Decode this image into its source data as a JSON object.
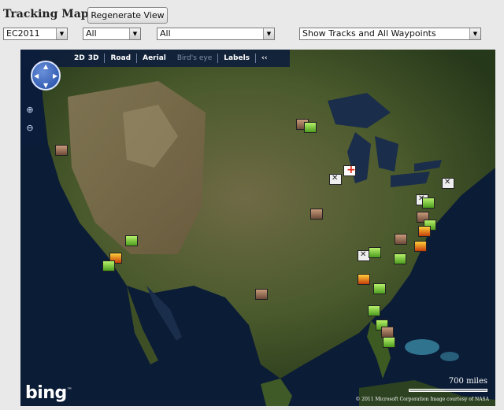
{
  "header": {
    "title": "Tracking Map",
    "regenerate_label": "Regenerate View"
  },
  "filters": {
    "event": "EC2011",
    "filter2": "All",
    "filter3": "All",
    "display_mode": "Show Tracks and All Waypoints"
  },
  "map": {
    "nav": {
      "view_2d": "2D",
      "view_3d": "3D",
      "road": "Road",
      "aerial": "Aerial",
      "birds_eye": "Bird's eye",
      "labels": "Labels",
      "collapse": "‹‹"
    },
    "logo": "bing",
    "scale_label": "700 miles",
    "copyright": "© 2011 Microsoft Corporation    Image courtesy of NASA"
  }
}
